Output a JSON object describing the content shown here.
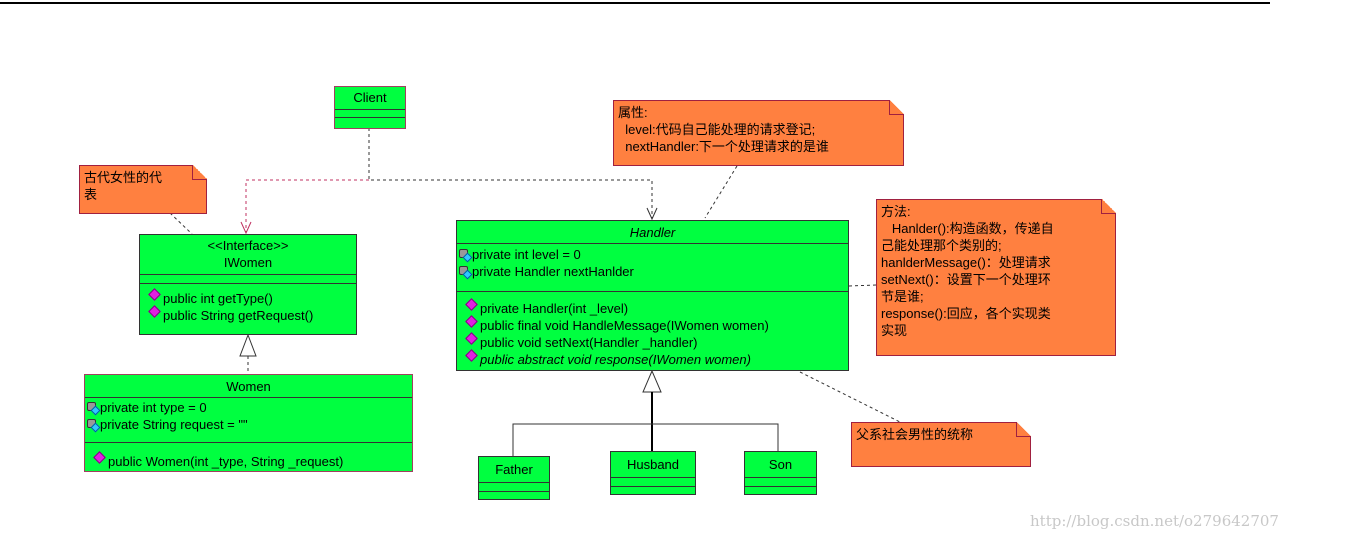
{
  "client": {
    "name": "Client"
  },
  "iwomen": {
    "stereotype": "<<Interface>>",
    "name": "IWomen",
    "methods": [
      "public int getType()",
      "public String getRequest()"
    ]
  },
  "women": {
    "name": "Women",
    "attributes": [
      "private int type = 0",
      "private String request = \"\""
    ],
    "methods": [
      "public Women(int _type, String _request)"
    ]
  },
  "handler": {
    "name": "Handler",
    "attributes": [
      "private int level = 0",
      "private Handler nextHanlder"
    ],
    "methods": [
      "private Handler(int _level)",
      "public final void HandleMessage(IWomen women)",
      "public void setNext(Handler _handler)",
      "public abstract void response(IWomen women)"
    ]
  },
  "subclasses": {
    "father": "Father",
    "husband": "Husband",
    "son": "Son"
  },
  "notes": {
    "women_note": [
      "古代女性的代",
      "表"
    ],
    "attr_note": [
      "属性:",
      "  level:代码自己能处理的请求登记;",
      "  nextHandler:下一个处理请求的是谁"
    ],
    "method_note": [
      "方法:",
      "   Hanlder():构造函数，传递自",
      "己能处理那个类别的;",
      "hanlderMessage()：处理请求",
      "setNext()：设置下一个处理环",
      "节是谁;",
      "response():回应，各个实现类",
      "实现"
    ],
    "men_note": [
      "父系社会男性的统称"
    ]
  },
  "watermark": "http://blog.csdn.net/o279642707",
  "colors": {
    "class_fill": "#00ff40",
    "note_fill": "#ff8040",
    "border": "#a04060"
  }
}
